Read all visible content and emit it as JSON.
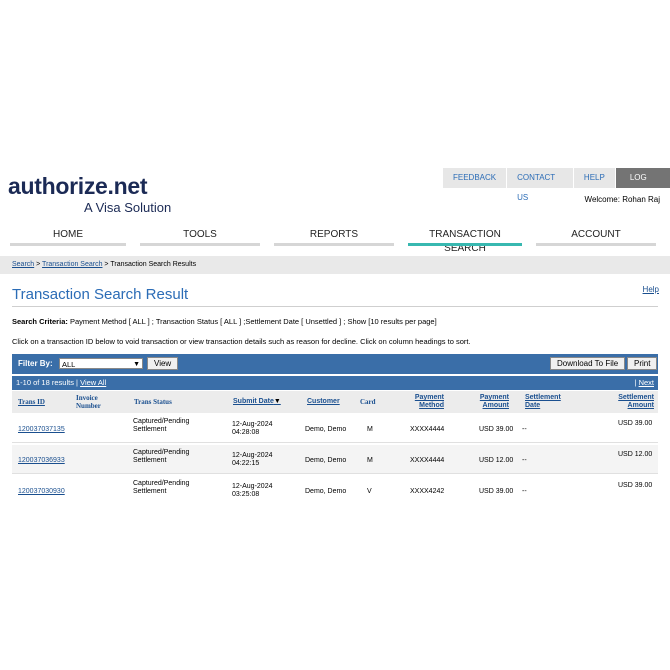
{
  "brand": {
    "logo_word": "authorize",
    "logo_dot": ".",
    "logo_tld": "net",
    "tagline": "A Visa Solution"
  },
  "topnav": {
    "feedback": "FEEDBACK",
    "contact": "CONTACT US",
    "help": "HELP",
    "logout": "LOG OUT"
  },
  "welcome": "Welcome: Rohan Raj",
  "mainnav": {
    "home": "HOME",
    "tools": "TOOLS",
    "reports": "REPORTS",
    "transaction_search": "TRANSACTION SEARCH",
    "account": "ACCOUNT"
  },
  "breadcrumb": {
    "search": "Search",
    "sep": " > ",
    "transaction_search": "Transaction Search",
    "current": "Transaction Search Results"
  },
  "page": {
    "title": "Transaction Search Result",
    "help": "Help"
  },
  "criteria": {
    "label": "Search Criteria:",
    "text": " Payment Method [ ALL ] ; Transaction Status [ ALL ] ;Settlement Date [ Unsettled ] ; Show [10 results per page]"
  },
  "instructions": "Click on a transaction ID below to void transaction or view transaction details such as reason for decline. Click on column headings to sort.",
  "filter": {
    "label": "Filter By:",
    "selected": "ALL",
    "view_button": "View",
    "download_button": "Download To File",
    "print_button": "Print"
  },
  "pagination": {
    "summary": "1-10 of 18 results | ",
    "view_all": "View All",
    "next": "Next",
    "next_prefix": "| "
  },
  "columns": {
    "trans_id": "Trans ID",
    "invoice_1": "Invoice",
    "invoice_2": "Number",
    "trans_status": "Trans Status",
    "submit_date": "Submit Date",
    "customer": "Customer",
    "card": "Card",
    "payment_method_1": "Payment",
    "payment_method_2": "Method",
    "payment_amount_1": "Payment",
    "payment_amount_2": "Amount",
    "settlement_date_1": "Settlement",
    "settlement_date_2": "Date",
    "settlement_amount_1": "Settlement",
    "settlement_amount_2": "Amount"
  },
  "rows": [
    {
      "trans_id": "120037037135",
      "status_1": "Captured/Pending",
      "status_2": "Settlement",
      "date_1": "12-Aug-2024",
      "date_2": "04:28:08",
      "customer": "Demo, Demo",
      "card": "M",
      "payment_method": "XXXX4444",
      "payment_amount": "USD 39.00",
      "settlement_date": "--",
      "settlement_amount": "USD 39.00"
    },
    {
      "trans_id": "120037036933",
      "status_1": "Captured/Pending",
      "status_2": "Settlement",
      "date_1": "12-Aug-2024",
      "date_2": "04:22:15",
      "customer": "Demo, Demo",
      "card": "M",
      "payment_method": "XXXX4444",
      "payment_amount": "USD 12.00",
      "settlement_date": "--",
      "settlement_amount": "USD 12.00"
    },
    {
      "trans_id": "120037030930",
      "status_1": "Captured/Pending",
      "status_2": "Settlement",
      "date_1": "12-Aug-2024",
      "date_2": "03:25:08",
      "customer": "Demo, Demo",
      "card": "V",
      "payment_method": "XXXX4242",
      "payment_amount": "USD 39.00",
      "settlement_date": "--",
      "settlement_amount": "USD 39.00"
    }
  ],
  "icons": {
    "sort_indicator": "sort-desc-icon",
    "select_caret": "chevron-down-icon"
  },
  "colors": {
    "brand_navy": "#1b2a55",
    "link_blue": "#2b6cb6",
    "bar_blue": "#3a6ea8",
    "active_tab": "#38b8b0",
    "logout_bg": "#747474"
  }
}
